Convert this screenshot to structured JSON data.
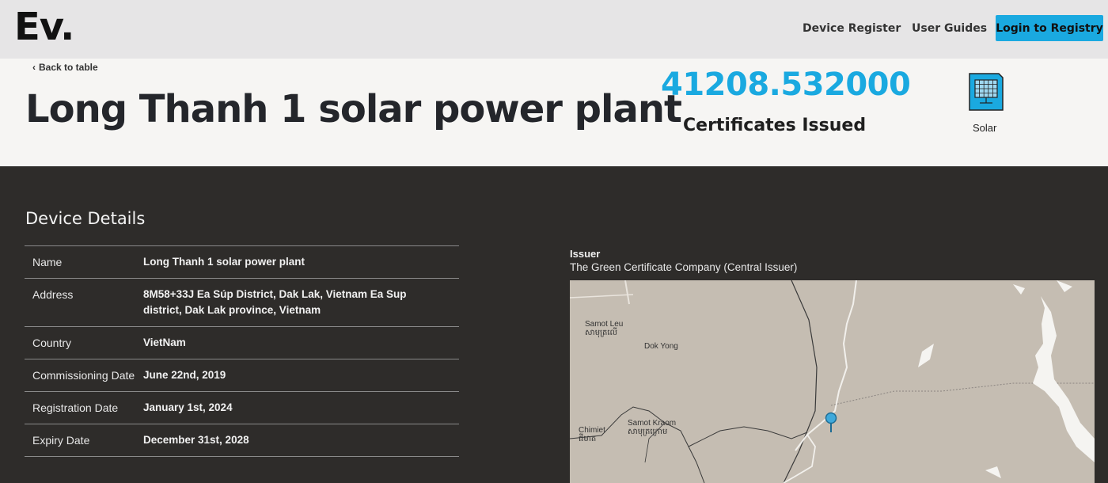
{
  "header": {
    "logo": "Ev.",
    "nav": {
      "device_register": "Device Register",
      "user_guides": "User Guides",
      "login": "Login to Registry"
    }
  },
  "hero": {
    "back_link": "Back to table",
    "title": "Long Thanh 1 solar power plant",
    "certificates_value": "41208.532000",
    "certificates_label": "Certificates Issued",
    "technology": "Solar",
    "technology_icon": "solar-panel-icon"
  },
  "details": {
    "heading": "Device Details",
    "rows": [
      {
        "label": "Name",
        "value": "Long Thanh 1 solar power plant"
      },
      {
        "label": "Address",
        "value": "8M58+33J Ea Súp District, Dak Lak, Vietnam Ea Sup district, Dak Lak province, Vietnam"
      },
      {
        "label": "Country",
        "value": "VietNam"
      },
      {
        "label": "Commissioning Date",
        "value": "June 22nd, 2019"
      },
      {
        "label": "Registration Date",
        "value": "January 1st, 2024"
      },
      {
        "label": "Expiry Date",
        "value": "December 31st, 2028"
      }
    ]
  },
  "issuer": {
    "label": "Issuer",
    "name": "The Green Certificate Company (Central Issuer)"
  },
  "map": {
    "places": [
      {
        "name": "Samot Leu",
        "native": "សាមុត្រលើ"
      },
      {
        "name": "Dok Yong",
        "native": ""
      },
      {
        "name": "Samot Kraom",
        "native": "សាមុត្រក្រោម"
      },
      {
        "name": "Chimiet",
        "native": "ជីមាត"
      }
    ],
    "marker_icon": "map-pin-icon"
  },
  "colors": {
    "accent": "#1aa9e0",
    "dark_bg": "#2e2c2a",
    "hero_bg": "#f6f5f3",
    "topbar_bg": "#e6e5e6",
    "map_bg": "#c5bdb2"
  }
}
